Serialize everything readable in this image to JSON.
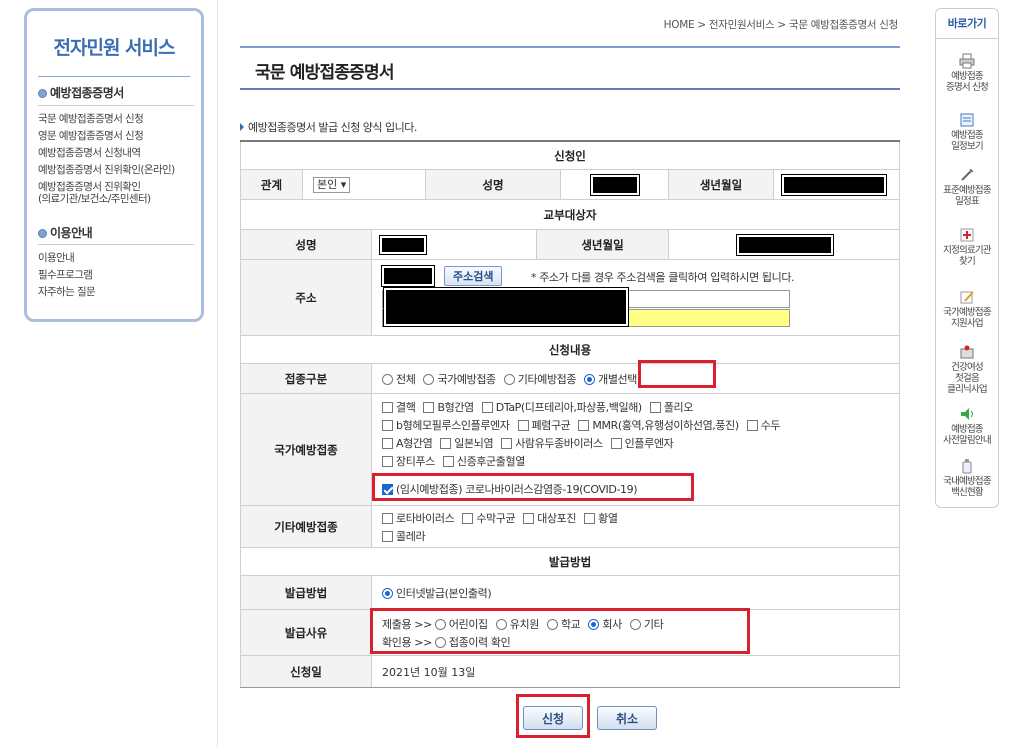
{
  "sidebar": {
    "title": "전자민원 서비스",
    "section1": "예방접종증명서",
    "items1": [
      "국문 예방접종증명서 신청",
      "영문 예방접종증명서 신청",
      "예방접종증명서 신청내역",
      "예방접종증명서 진위확인(온라인)",
      "예방접종증명서 진위확인",
      "(의료기관/보건소/주민센터)"
    ],
    "section2": "이용안내",
    "items2": [
      "이용안내",
      "필수프로그램",
      "자주하는 질문"
    ]
  },
  "breadcrumb": "HOME > 전자민원서비스 > 국문 예방접종증명서 신청",
  "page_title": "국문 예방접종증명서",
  "description": "예방접종증명서 발급 신청 양식 입니다.",
  "form": {
    "applicant_section": "신청인",
    "relation_label": "관계",
    "relation_value": "본인 ▾",
    "name_label": "성명",
    "birth_label": "생년월일",
    "recipient_section": "교부대상자",
    "r_name_label": "성명",
    "r_birth_label": "생년월일",
    "address_label": "주소",
    "address_search_button": "주소검색",
    "address_hint": "* 주소가 다를 경우 주소검색을 클릭하여 입력하시면 됩니다.",
    "content_section": "신청내용",
    "vaccine_type_label": "접종구분",
    "vaccine_types": [
      "전체",
      "국가예방접종",
      "기타예방접종",
      "개별선택"
    ],
    "national_label": "국가예방접종",
    "national_vaccines": [
      [
        "결핵",
        "B형간염",
        "DTaP(디프테리아,파상풍,백일해)",
        "폴리오"
      ],
      [
        "b형헤모필루스인플루엔자",
        "폐렴구균",
        "MMR(홍역,유행성이하선염,풍진)",
        "수두"
      ],
      [
        "A형간염",
        "일본뇌염",
        "사람유두종바이러스",
        "인플루엔자"
      ],
      [
        "장티푸스",
        "신증후군출혈열"
      ]
    ],
    "covid_vaccine": "(임시예방접종) 코로나바이러스감염증-19(COVID-19)",
    "other_label": "기타예방접종",
    "other_vaccines": [
      [
        "로타바이러스",
        "수막구균",
        "대상포진",
        "황열"
      ],
      [
        "콜레라"
      ]
    ],
    "issue_section": "발급방법",
    "issue_method_label": "발급방법",
    "issue_method": "인터넷발급(본인출력)",
    "issue_reason_label": "발급사유",
    "submit_prefix": "제출용 >>",
    "submit_options": [
      "어린이집",
      "유치원",
      "학교",
      "회사",
      "기타"
    ],
    "confirm_prefix": "확인용 >>",
    "confirm_option": "접종이력 확인",
    "date_label": "신청일",
    "date_value": "2021년 10월 13일"
  },
  "buttons": {
    "apply": "신청",
    "cancel": "취소"
  },
  "quick": {
    "title": "바로가기",
    "items": [
      [
        "예방접종",
        "증명서 신청"
      ],
      [
        "예방접종",
        "일정보기"
      ],
      [
        "표준예방접종",
        "일정표"
      ],
      [
        "지정의료기관",
        "찾기"
      ],
      [
        "국가예방접종",
        "지원사업"
      ],
      [
        "건강여성",
        "첫걸음",
        "클리닉사업"
      ],
      [
        "예방접종",
        "사전알림안내"
      ],
      [
        "국내예방접종",
        "백신현황"
      ]
    ]
  },
  "colors": {
    "accent": "#3b6db4",
    "highlight_red": "#d8202f",
    "radio_blue": "#1a66d0",
    "yellow_field": "#ffff88"
  }
}
